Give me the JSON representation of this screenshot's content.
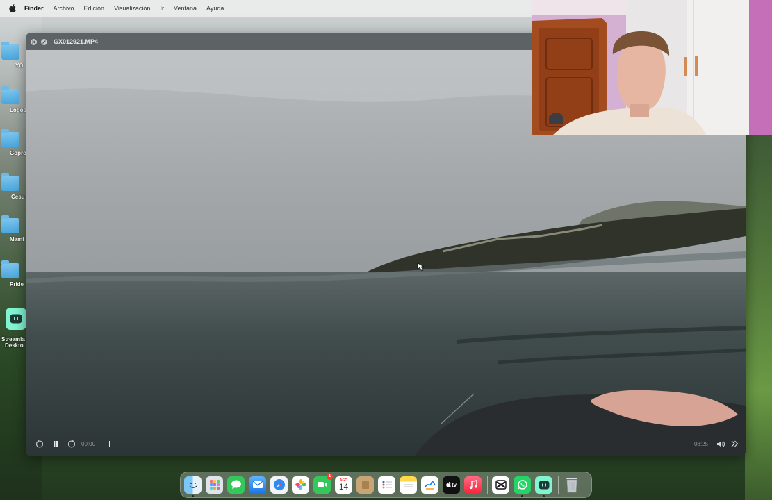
{
  "menubar": {
    "app_name": "Finder",
    "items": [
      "Archivo",
      "Edición",
      "Visualización",
      "Ir",
      "Ventana",
      "Ayuda"
    ]
  },
  "desktop": {
    "items": [
      {
        "label": "YO",
        "icon": "folder-icon"
      },
      {
        "label": "Logos",
        "icon": "folder-icon"
      },
      {
        "label": "Gopro",
        "icon": "folder-icon"
      },
      {
        "label": "Cesu",
        "icon": "folder-icon"
      },
      {
        "label": "Mami",
        "icon": "folder-icon"
      },
      {
        "label": "Pride",
        "icon": "folder-icon"
      }
    ],
    "app_shortcut": {
      "line1": "Streamla",
      "line2": "Deskto",
      "icon": "streamlabs-icon"
    }
  },
  "player": {
    "title": "GX012921.MP4",
    "current_time": "00:00",
    "remaining_time": "08:25",
    "state": "playing",
    "progress": 0.0
  },
  "dock": {
    "calendar_month": "AGO",
    "calendar_day": "14",
    "facetime_badge": "1",
    "apps": [
      "Finder",
      "Launchpad",
      "Messages",
      "Mail",
      "Safari",
      "Photos",
      "FaceTime",
      "Calendar",
      "Notes",
      "Reminders",
      "Stickies",
      "Freeform",
      "TV",
      "Music",
      "CapCut",
      "WhatsApp",
      "Streamlabs",
      "Trash"
    ],
    "tv_label": "tv"
  },
  "colors": {
    "menubar_bg": "#ececec",
    "player_chrome": "#5d6364",
    "folder_blue": "#4aa6dc",
    "webcam_wall": "#d9b5d6"
  }
}
